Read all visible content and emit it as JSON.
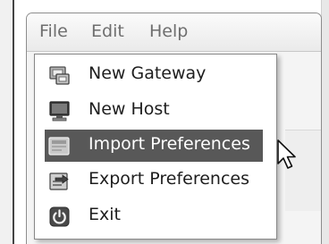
{
  "menubar": {
    "items": [
      {
        "label": "File"
      },
      {
        "label": "Edit"
      },
      {
        "label": "Help"
      }
    ]
  },
  "file_menu": {
    "items": [
      {
        "label": "New Gateway",
        "icon": "gateway-icon"
      },
      {
        "label": "New Host",
        "icon": "monitor-icon"
      },
      {
        "label": "Import Preferences",
        "icon": "import-icon",
        "highlighted": true
      },
      {
        "label": "Export Preferences",
        "icon": "export-icon"
      },
      {
        "label": "Exit",
        "icon": "power-icon"
      }
    ]
  },
  "colors": {
    "highlight": "#585858",
    "menubar_text": "#6e6e6e",
    "menu_text": "#1e1e1e"
  }
}
